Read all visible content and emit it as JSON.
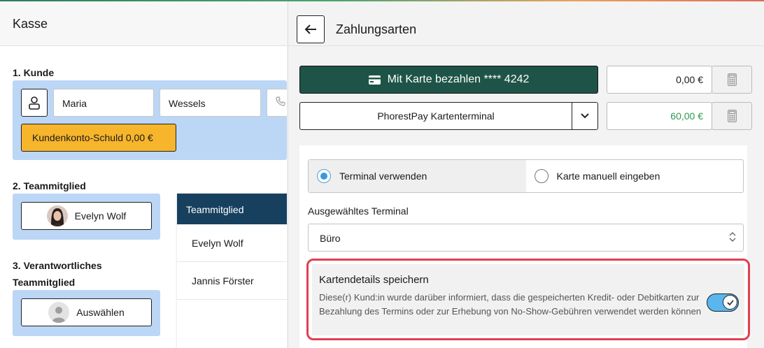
{
  "colors": {
    "accent_dark_green": "#1e5447",
    "selected_blue": "#bcd6f6",
    "debt_orange": "#f7b52c",
    "highlight_red": "#e23e52",
    "green_amount": "#2b9a4f"
  },
  "left": {
    "title": "Kasse",
    "customer": {
      "section": "1. Kunde",
      "first_name": "Maria",
      "last_name": "Wessels",
      "debt_label": "Kundenkonto-Schuld 0,00 €"
    },
    "team_member": {
      "section": "2. Teammitglied",
      "selected": "Evelyn Wolf"
    },
    "responsible": {
      "section_line1": "3. Verantwortliches",
      "section_line2": "Teammitglied",
      "button_label": "Auswählen"
    },
    "dropdown": {
      "header": "Teammitglied",
      "items": [
        "Evelyn Wolf",
        "Jannis Förster"
      ]
    }
  },
  "right": {
    "title": "Zahlungsarten",
    "card_button": "Mit Karte bezahlen **** 4242",
    "card_amount": "0,00 €",
    "terminal_name": "PhorestPay Kartenterminal",
    "terminal_amount": "60,00 €",
    "radio": {
      "option1": "Terminal verwenden",
      "option2": "Karte manuell eingeben",
      "selected": "Terminal verwenden"
    },
    "selected_terminal_label": "Ausgewähltes Terminal",
    "selected_terminal_value": "Büro",
    "save_card": {
      "title": "Kartendetails speichern",
      "description": "Diese(r) Kund:in wurde darüber informiert, dass die gespeicherten Kredit- oder Debitkarten zur Bezahlung des Termins oder zur Erhebung von No-Show-Gebühren verwendet werden können",
      "enabled": true
    }
  }
}
